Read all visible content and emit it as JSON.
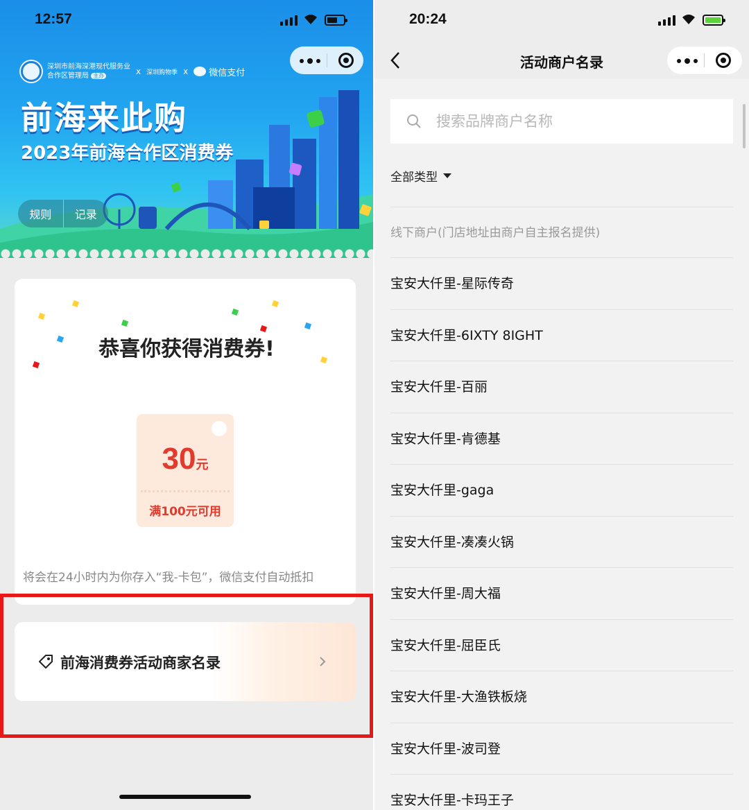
{
  "left_screen": {
    "status_time": "12:57",
    "banner": {
      "org_line1": "深圳市前海深港现代服务业",
      "org_line2": "合作区管理局",
      "org_badge": "主办",
      "partner2": "深圳购物季",
      "separator": "x",
      "wechat_pay": "微信支付",
      "title": "前海来此购",
      "subtitle": "2023年前海合作区消费券",
      "rules_label": "规则",
      "records_label": "记录"
    },
    "congrats_title": "恭喜你获得消费券!",
    "coupon": {
      "amount": "30",
      "unit": "元",
      "condition": "满100元可用"
    },
    "notice": "将会在24小时内为你存入“我-卡包”，微信支付自动抵扣",
    "merchant_link_label": "前海消费券活动商家名录"
  },
  "right_screen": {
    "status_time": "20:24",
    "title": "活动商户名录",
    "search_placeholder": "搜索品牌商户名称",
    "filter_label": "全部类型",
    "section_header": "线下商户(门店地址由商户自主报名提供)",
    "merchants": [
      "宝安大仟里-星际传奇",
      "宝安大仟里-6IXTY 8IGHT",
      "宝安大仟里-百丽",
      "宝安大仟里-肯德基",
      "宝安大仟里-gaga",
      "宝安大仟里-凑凑火锅",
      "宝安大仟里-周大福",
      "宝安大仟里-屈臣氏",
      "宝安大仟里-大渔铁板烧",
      "宝安大仟里-波司登",
      "宝安大仟里-卡玛王子"
    ]
  },
  "colors": {
    "coupon_red": "#e23b2e",
    "highlight_box": "#e81818",
    "banner_blue": "#1a8ee8"
  }
}
